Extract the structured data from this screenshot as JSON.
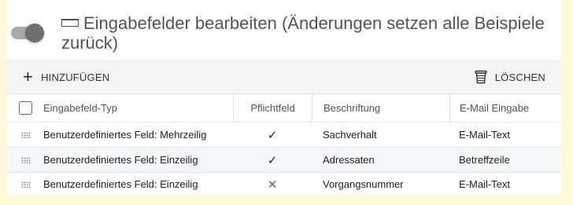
{
  "header": {
    "title_line1": "Eingabefelder bearbeiten (Änderungen setzen alle Beispiele",
    "title_line2": "zurück)",
    "toggle_on": true
  },
  "toolbar": {
    "add_label": "HINZUFÜGEN",
    "delete_label": "LÖSCHEN"
  },
  "table": {
    "columns": [
      "Eingabefeld-Typ",
      "Pflichtfeld",
      "Beschriftung",
      "E-Mail Eingabe"
    ],
    "rows": [
      {
        "type": "Benutzerdefiniertes Feld: Mehrzeilig",
        "required": "✓",
        "label": "Sachverhalt",
        "email": "E-Mail-Text"
      },
      {
        "type": "Benutzerdefiniertes Feld: Einzeilig",
        "required": "✓",
        "label": "Adressaten",
        "email": "Betreffzeile"
      },
      {
        "type": "Benutzerdefiniertes Feld: Einzeilig",
        "required": "✕",
        "label": "Vorgangsnummer",
        "email": "E-Mail-Text"
      }
    ]
  },
  "colors": {
    "page_background": "#fcf7d8",
    "toolbar_background": "#f4f4f4",
    "alt_row": "#f5f8fb"
  }
}
